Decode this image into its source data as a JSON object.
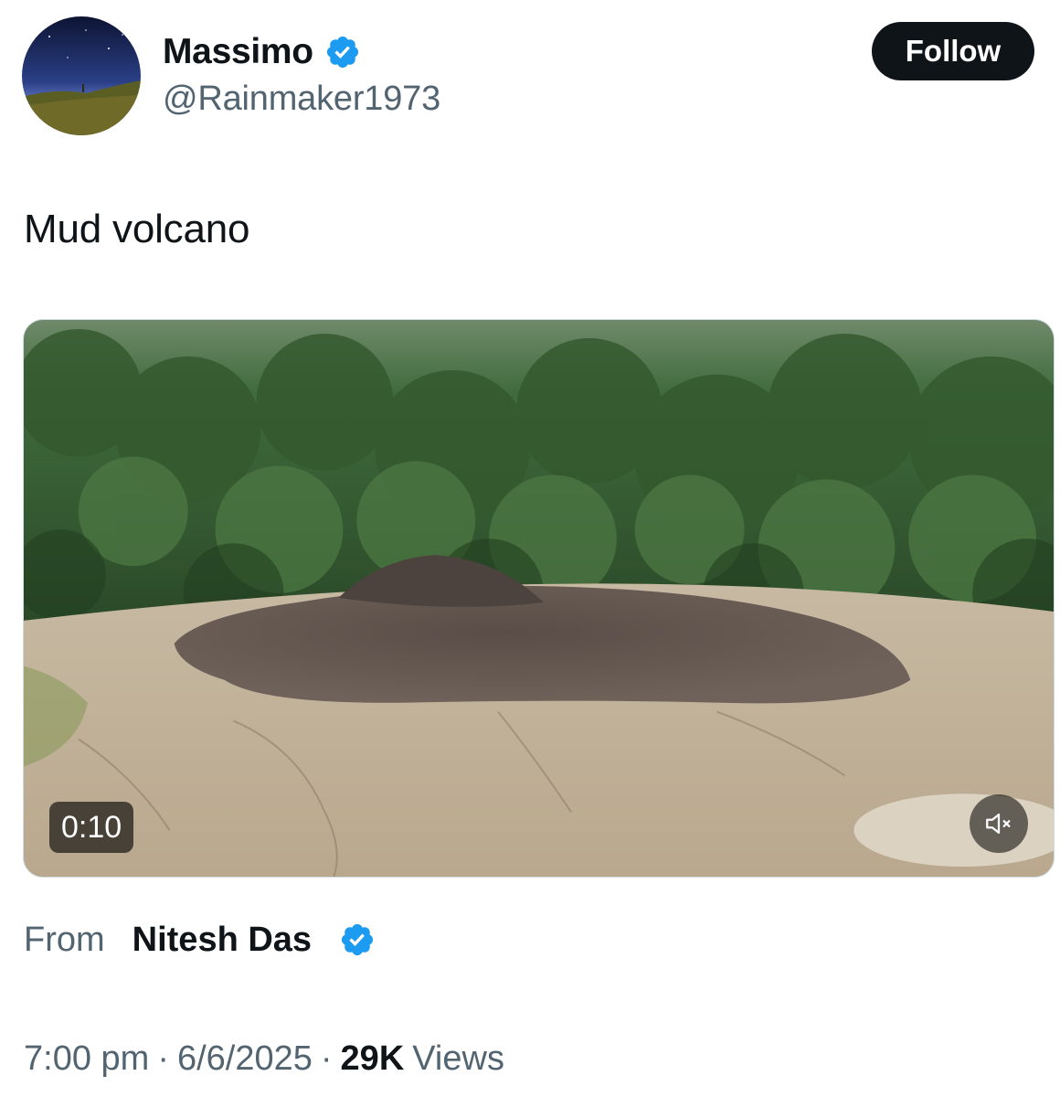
{
  "author": {
    "display_name": "Massimo",
    "handle": "@Rainmaker1973",
    "verified": true
  },
  "follow_label": "Follow",
  "post": {
    "text": "Mud volcano"
  },
  "media": {
    "type": "video",
    "duration": "0:10",
    "muted": true
  },
  "source": {
    "prefix": "From",
    "name": "Nitesh Das",
    "verified": true
  },
  "meta": {
    "time": "7:00 pm",
    "separator": "·",
    "date": "6/6/2025",
    "views_count": "29K",
    "views_label": "Views"
  },
  "colors": {
    "verified_badge": "#1d9bf0",
    "follow_button_bg": "#0f1419",
    "secondary_text": "#536471"
  }
}
